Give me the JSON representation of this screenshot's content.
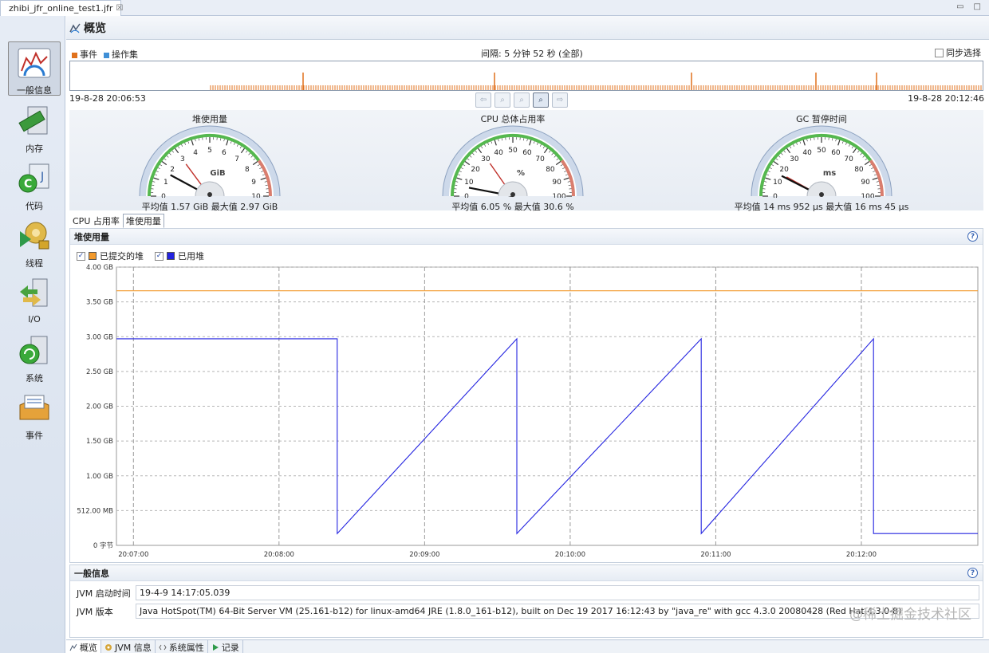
{
  "editor_tab": {
    "label": "zhibi_jfr_online_test1.jfr",
    "close": "☒"
  },
  "window_controls": {
    "minimize": "▭",
    "maximize": "□"
  },
  "sidebar": {
    "items": [
      {
        "label": "一般信息",
        "icon": "gauge-chart-icon"
      },
      {
        "label": "内存",
        "icon": "memory-icon"
      },
      {
        "label": "代码",
        "icon": "code-icon"
      },
      {
        "label": "线程",
        "icon": "threads-icon"
      },
      {
        "label": "I/O",
        "icon": "io-icon"
      },
      {
        "label": "系统",
        "icon": "system-icon"
      },
      {
        "label": "事件",
        "icon": "events-icon"
      }
    ]
  },
  "page": {
    "title": "概览"
  },
  "timeline": {
    "legend": [
      {
        "label": "事件",
        "color": "#e0711c"
      },
      {
        "label": "操作集",
        "color": "#3f8fd6"
      }
    ],
    "interval_label": "间隔: 5 分钟 52 秒 (全部)",
    "sync_label": "同步选择",
    "start": "19-8-28 20:06:53",
    "end": "19-8-28 20:12:46"
  },
  "gauges": [
    {
      "title": "堆使用量",
      "unit": "GiB",
      "ticks": [
        "0",
        "1",
        "2",
        "3",
        "4",
        "5",
        "6",
        "7",
        "8",
        "9",
        "10"
      ],
      "max": 10,
      "value": 1.57,
      "peak": 2.97,
      "stats": "平均值 1.57 GiB   最大值 2.97 GiB"
    },
    {
      "title": "CPU 总体占用率",
      "unit": "%",
      "ticks": [
        "0",
        "10",
        "20",
        "30",
        "40",
        "50",
        "60",
        "70",
        "80",
        "90",
        "100"
      ],
      "max": 100,
      "value": 6.05,
      "peak": 30.6,
      "stats": "平均值 6.05 %   最大值 30.6 %"
    },
    {
      "title": "GC 暂停时间",
      "unit": "ms",
      "ticks": [
        "0",
        "10",
        "20",
        "30",
        "40",
        "50",
        "60",
        "70",
        "80",
        "90",
        "100"
      ],
      "max": 100,
      "value": 14.952,
      "peak": 16.045,
      "stats": "平均值 14 ms 952 μs   最大值 16 ms 45 μs"
    }
  ],
  "subtabs": [
    "CPU 占用率",
    "堆使用量"
  ],
  "heap_panel": {
    "title": "堆使用量",
    "help": "?",
    "legend": [
      {
        "label": "已提交的堆",
        "color": "#f39a2c"
      },
      {
        "label": "已用堆",
        "color": "#2323e0"
      }
    ]
  },
  "chart_data": {
    "type": "line",
    "y_ticks": [
      "0 字节",
      "512.00 MB",
      "1.00 GB",
      "1.50 GB",
      "2.00 GB",
      "2.50 GB",
      "3.00 GB",
      "3.50 GB",
      "4.00 GB"
    ],
    "x_ticks": [
      "20:07:00",
      "20:08:00",
      "20:09:00",
      "20:10:00",
      "20:11:00",
      "20:12:00"
    ],
    "ylim_gb": [
      0,
      4
    ],
    "grid": true,
    "series": [
      {
        "name": "已提交的堆",
        "color": "#f39a2c",
        "x": [
          "20:06:53",
          "20:12:48"
        ],
        "y_gb": [
          3.66,
          3.66
        ]
      },
      {
        "name": "已用堆",
        "color": "#2323e0",
        "x": [
          "20:06:53",
          "20:08:24",
          "20:08:24",
          "20:09:38",
          "20:09:38",
          "20:10:54",
          "20:10:54",
          "20:12:05",
          "20:12:05",
          "20:12:48"
        ],
        "y_gb": [
          2.97,
          2.97,
          0.17,
          2.97,
          0.17,
          2.97,
          0.17,
          2.97,
          0.17,
          0.17
        ]
      }
    ]
  },
  "general_info": {
    "title": "一般信息",
    "help": "?",
    "rows": [
      {
        "label": "JVM 启动时间",
        "value": "19-4-9 14:17:05.039"
      },
      {
        "label": "JVM 版本",
        "value": "Java HotSpot(TM) 64-Bit Server VM (25.161-b12) for linux-amd64 JRE (1.8.0_161-b12), built on Dec 19 2017 16:12:43 by \"java_re\" with gcc 4.3.0 20080428 (Red Hat 4.3.0-8)"
      }
    ]
  },
  "bottom_tabs": [
    "概览",
    "JVM 信息",
    "系统属性",
    "记录"
  ],
  "watermark": "@稀土掘金技术社区"
}
